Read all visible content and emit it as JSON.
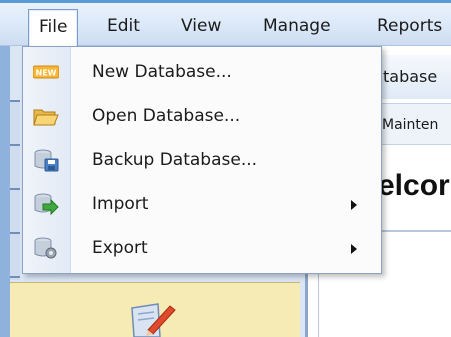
{
  "menubar": {
    "items": [
      {
        "label": "File"
      },
      {
        "label": "Edit"
      },
      {
        "label": "View"
      },
      {
        "label": "Manage"
      },
      {
        "label": "Reports"
      }
    ]
  },
  "file_menu": {
    "items": [
      {
        "label": "New Database...",
        "icon": "new-badge-icon"
      },
      {
        "label": "Open Database...",
        "icon": "folder-open-icon"
      },
      {
        "label": "Backup Database...",
        "icon": "database-save-icon"
      },
      {
        "label": "Import",
        "icon": "database-import-icon",
        "has_submenu": true
      },
      {
        "label": "Export",
        "icon": "database-export-icon",
        "has_submenu": true
      }
    ]
  },
  "background": {
    "tab1": "tabase",
    "tab2": "Mainten",
    "welcome": "elcor"
  },
  "colors": {
    "menubar_top": "#5b9bd5",
    "menubar_bg": "#dbe8f8",
    "panel_yellow": "#f6eab5"
  }
}
